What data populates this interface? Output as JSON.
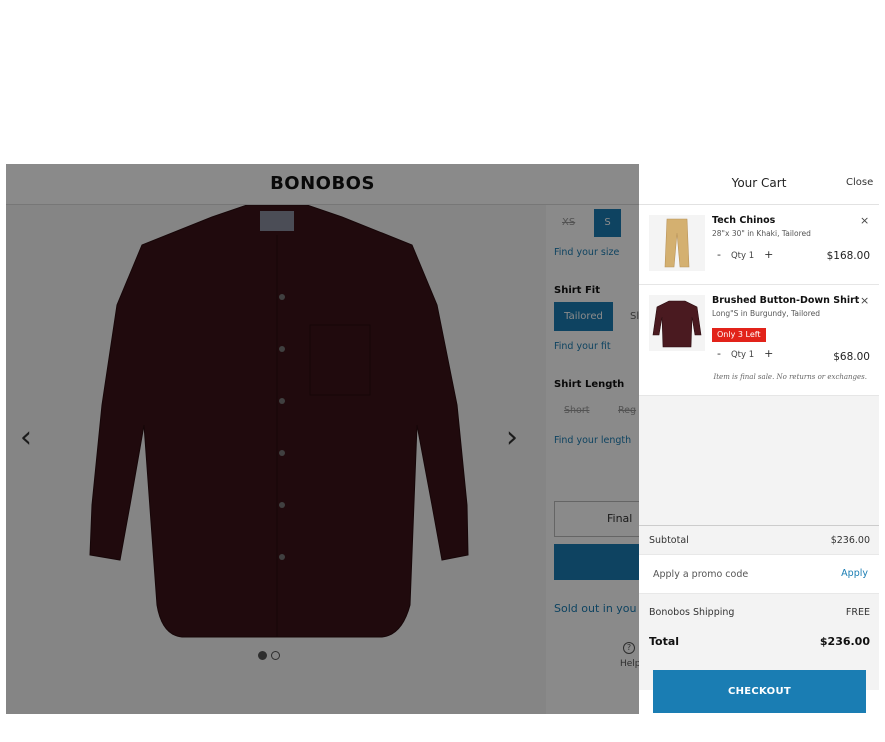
{
  "page": {
    "brand": "BONOBOS",
    "sizes": [
      "XS",
      "S"
    ],
    "find_size": "Find your size",
    "fit_label": "Shirt Fit",
    "fit_options": [
      "Tailored",
      "Sl"
    ],
    "find_fit": "Find your fit",
    "length_label": "Shirt Length",
    "length_options": [
      "Short",
      "Reg"
    ],
    "find_length": "Find your length",
    "final_sale_button": "Final",
    "sold_out_text": "Sold out in you",
    "help_icon": "?",
    "help_label": "Help",
    "gallery_prev": "‹",
    "gallery_next": "›",
    "product_color": "#3c1418"
  },
  "cart": {
    "title": "Your Cart",
    "close": "Close",
    "items": [
      {
        "name": "Tech Chinos",
        "desc": "28\"x 30\" in Khaki, Tailored",
        "qty": "Qty 1",
        "price": "$168.00",
        "remove": "×"
      },
      {
        "name": "Brushed Button-Down Shirt",
        "desc": "Long\"S in Burgundy, Tailored",
        "badge": "Only 3 Left",
        "qty": "Qty 1",
        "price": "$68.00",
        "note": "Item is final sale. No returns or exchanges.",
        "remove": "×"
      }
    ],
    "subtotal_label": "Subtotal",
    "subtotal_value": "$236.00",
    "promo_placeholder": "Apply a promo code",
    "promo_apply": "Apply",
    "shipping_label": "Bonobos Shipping",
    "shipping_value": "FREE",
    "total_label": "Total",
    "total_value": "$236.00",
    "checkout": "CHECKOUT"
  },
  "colors": {
    "accent": "#1a7db3",
    "badge": "#e2231a",
    "overlay": "rgba(0,0,0,0.46)"
  }
}
